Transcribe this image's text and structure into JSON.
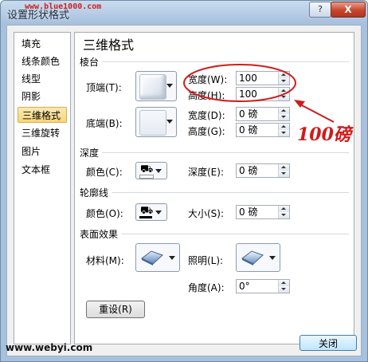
{
  "window": {
    "title": "设置形状格式",
    "watermark": "www.blue1000.com",
    "help_label": "?",
    "close_label": "X"
  },
  "nav": {
    "items": [
      {
        "label": "填充"
      },
      {
        "label": "线条颜色"
      },
      {
        "label": "线型"
      },
      {
        "label": "阴影"
      },
      {
        "label": "三维格式"
      },
      {
        "label": "三维旋转"
      },
      {
        "label": "图片"
      },
      {
        "label": "文本框"
      }
    ],
    "selected_index": 4
  },
  "panel": {
    "title": "三维格式",
    "bevel": {
      "heading": "棱台",
      "top_label": "顶端(T):",
      "bottom_label": "底端(B):",
      "top_width_label": "宽度(W):",
      "top_width_value": "100",
      "top_height_label": "高度(H):",
      "top_height_value": "100",
      "bottom_width_label": "宽度(D):",
      "bottom_width_value": "0 磅",
      "bottom_height_label": "高度(G):",
      "bottom_height_value": "0 磅"
    },
    "depth": {
      "heading": "深度",
      "color_label": "颜色(C):",
      "depth_label": "深度(E):",
      "depth_value": "0 磅"
    },
    "contour": {
      "heading": "轮廓线",
      "color_label": "颜色(O):",
      "size_label": "大小(S):",
      "size_value": "0 磅"
    },
    "surface": {
      "heading": "表面效果",
      "material_label": "材料(M):",
      "lighting_label": "照明(L):",
      "angle_label": "角度(A):",
      "angle_value": "0°"
    },
    "reset_label": "重设(R)"
  },
  "footer": {
    "close_label": "关闭",
    "watermark": "www.webyi.com"
  },
  "annotation": {
    "text": "100磅"
  },
  "colors": {
    "depth_color": "#ffffff",
    "contour_color": "#000000",
    "annotation_red": "#d11a1a",
    "selected_bg": "#f7d57a"
  }
}
